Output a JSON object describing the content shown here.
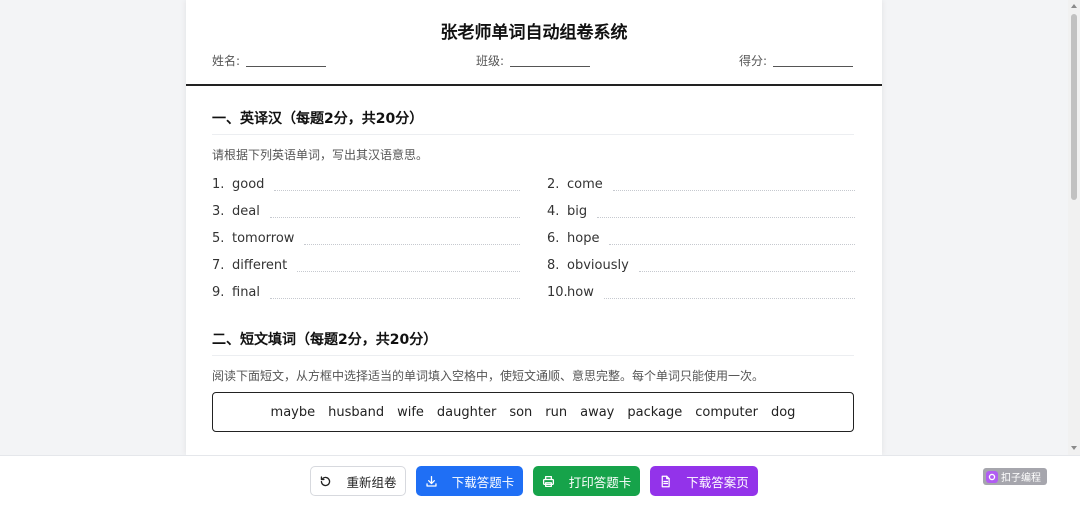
{
  "paper": {
    "title": "张老师单词自动组卷系统",
    "fields": {
      "name_label": "姓名:",
      "class_label": "班级:",
      "score_label": "得分:"
    }
  },
  "section1": {
    "title": "一、英译汉（每题2分，共20分）",
    "desc": "请根据下列英语单词，写出其汉语意思。",
    "items": [
      {
        "num": "1.",
        "word": "good"
      },
      {
        "num": "2.",
        "word": "come"
      },
      {
        "num": "3.",
        "word": "deal"
      },
      {
        "num": "4.",
        "word": "big"
      },
      {
        "num": "5.",
        "word": "tomorrow"
      },
      {
        "num": "6.",
        "word": "hope"
      },
      {
        "num": "7.",
        "word": "different"
      },
      {
        "num": "8.",
        "word": "obviously"
      },
      {
        "num": "9.",
        "word": "final"
      },
      {
        "num": "10.",
        "word": "how"
      }
    ]
  },
  "section2": {
    "title": "二、短文填词（每题2分，共20分）",
    "desc": "阅读下面短文，从方框中选择适当的单词填入空格中，使短文通顺、意思完整。每个单词只能使用一次。",
    "words": [
      "maybe",
      "husband",
      "wife",
      "daughter",
      "son",
      "run",
      "away",
      "package",
      "computer",
      "dog"
    ]
  },
  "toolbar": {
    "reset_label": "重新组卷",
    "download_card_label": "下载答题卡",
    "print_card_label": "打印答题卡",
    "download_answers_label": "下载答案页"
  },
  "watermark": {
    "text": "扣子编程"
  },
  "colors": {
    "download_card": "#1f6ff5",
    "print_card": "#16a34a",
    "download_answers": "#9333ea",
    "page_bg": "#f3f4f6"
  },
  "icons": {
    "reset": "refresh-icon",
    "download": "download-icon",
    "print": "printer-icon",
    "document": "document-icon"
  }
}
